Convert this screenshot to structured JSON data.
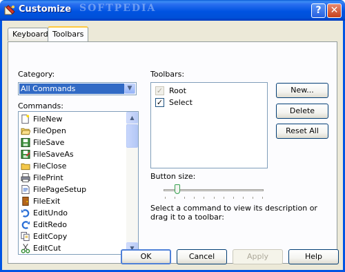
{
  "window": {
    "title": "Customize",
    "watermark": "SOFTPEDIA"
  },
  "tabs": [
    {
      "label": "Keyboard",
      "active": false
    },
    {
      "label": "Toolbars",
      "active": true
    }
  ],
  "category": {
    "label": "Category:",
    "value": "All Commands"
  },
  "commands": {
    "label": "Commands:",
    "items": [
      {
        "label": "FileNew",
        "icon": "new-file-icon"
      },
      {
        "label": "FileOpen",
        "icon": "open-folder-icon"
      },
      {
        "label": "FileSave",
        "icon": "save-disk-icon"
      },
      {
        "label": "FileSaveAs",
        "icon": "save-as-disk-icon"
      },
      {
        "label": "FileClose",
        "icon": "close-folder-icon"
      },
      {
        "label": "FilePrint",
        "icon": "printer-icon"
      },
      {
        "label": "FilePageSetup",
        "icon": "page-setup-icon"
      },
      {
        "label": "FileExit",
        "icon": "exit-door-icon"
      },
      {
        "label": "EditUndo",
        "icon": "undo-arrow-icon"
      },
      {
        "label": "EditRedo",
        "icon": "redo-arrow-icon"
      },
      {
        "label": "EditCopy",
        "icon": "copy-icon"
      },
      {
        "label": "EditCut",
        "icon": "scissors-icon"
      }
    ]
  },
  "toolbars": {
    "label": "Toolbars:",
    "items": [
      {
        "label": "Root",
        "checked": true,
        "disabled": true
      },
      {
        "label": "Select",
        "checked": true,
        "disabled": false
      }
    ]
  },
  "buttons": {
    "new": "New...",
    "delete": "Delete",
    "reset_all": "Reset All",
    "ok": "OK",
    "cancel": "Cancel",
    "apply": "Apply",
    "help": "Help"
  },
  "button_size": {
    "label": "Button size:",
    "level": 0.12
  },
  "description": "Select a command to view its description or drag it to a toolbar:",
  "colors": {
    "titlebar": "#0054e3",
    "selection": "#316ac5",
    "dialog_bg": "#ece9d8"
  }
}
